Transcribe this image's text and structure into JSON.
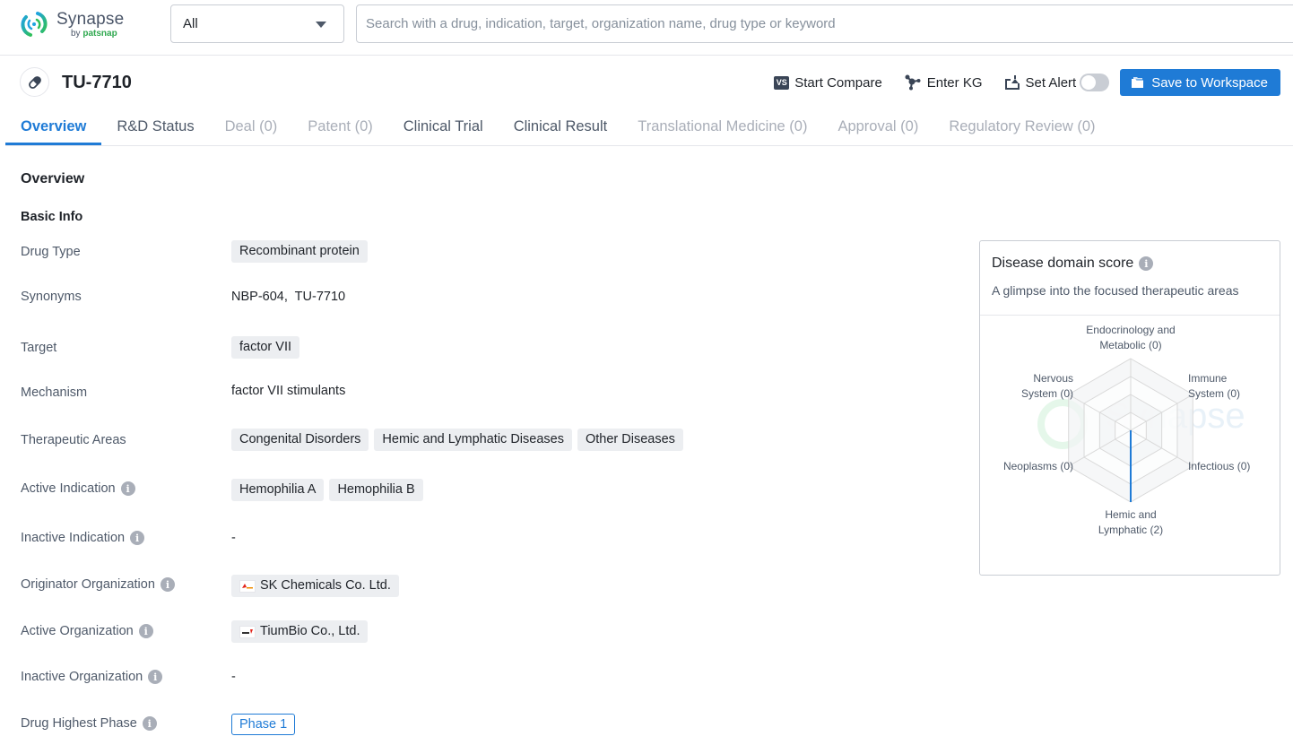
{
  "app": {
    "brand_name": "Synapse",
    "brand_sub_prefix": "by",
    "brand_sub_name": "patsnap"
  },
  "search": {
    "scope_value": "All",
    "placeholder": "Search with a drug, indication, target, organization name, drug type or keyword",
    "value": ""
  },
  "drug": {
    "name": "TU-7710",
    "icon": "pill-icon"
  },
  "actions": {
    "compare_badge": "VS",
    "compare_label": "Start Compare",
    "kg_label": "Enter KG",
    "alert_label": "Set Alert",
    "alert_on": false,
    "save_label": "Save to Workspace"
  },
  "tabs": [
    {
      "label": "Overview",
      "state": "active"
    },
    {
      "label": "R&D Status",
      "state": "enabled"
    },
    {
      "label": "Deal (0)",
      "state": "disabled"
    },
    {
      "label": "Patent (0)",
      "state": "disabled"
    },
    {
      "label": "Clinical Trial",
      "state": "enabled"
    },
    {
      "label": "Clinical Result",
      "state": "enabled"
    },
    {
      "label": "Translational Medicine (0)",
      "state": "disabled"
    },
    {
      "label": "Approval (0)",
      "state": "disabled"
    },
    {
      "label": "Regulatory Review (0)",
      "state": "disabled"
    }
  ],
  "overview": {
    "section_title": "Overview",
    "basic_info_title": "Basic Info",
    "fields": {
      "drug_type": {
        "label": "Drug Type",
        "tags": [
          "Recombinant protein"
        ]
      },
      "synonyms": {
        "label": "Synonyms",
        "text": "NBP-604,  TU-7710"
      },
      "target": {
        "label": "Target",
        "tags": [
          "factor VII"
        ]
      },
      "mechanism": {
        "label": "Mechanism",
        "text": "factor VII stimulants"
      },
      "therapeutic_areas": {
        "label": "Therapeutic Areas",
        "tags": [
          "Congenital Disorders",
          "Hemic and Lymphatic Diseases",
          "Other Diseases"
        ]
      },
      "active_indication": {
        "label": "Active Indication",
        "tags": [
          "Hemophilia A",
          "Hemophilia B"
        ]
      },
      "inactive_indication": {
        "label": "Inactive Indication",
        "text": "-"
      },
      "originator_org": {
        "label": "Originator Organization",
        "org": "SK Chemicals Co. Ltd."
      },
      "active_org": {
        "label": "Active Organization",
        "org": "TiumBio Co., Ltd."
      },
      "inactive_org": {
        "label": "Inactive Organization",
        "text": "-"
      },
      "highest_phase": {
        "label": "Drug Highest Phase",
        "phase": "Phase 1"
      }
    }
  },
  "disease_domain": {
    "title": "Disease domain score",
    "subtitle": "A glimpse into the focused therapeutic areas",
    "watermark": "Synapse by patsnap"
  },
  "chart_data": {
    "type": "radar",
    "title": "Disease domain score",
    "categories": [
      "Endocrinology and Metabolic",
      "Immune System",
      "Infectious",
      "Hemic and Lymphatic",
      "Neoplasms",
      "Nervous System"
    ],
    "labels": [
      [
        "Endocrinology and",
        "Metabolic (0)"
      ],
      [
        "Immune",
        "System (0)"
      ],
      [
        "Infectious (0)"
      ],
      [
        "Hemic and",
        "Lymphatic (2)"
      ],
      [
        "Neoplasms (0)"
      ],
      [
        "Nervous",
        "System (0)"
      ]
    ],
    "values": [
      0,
      0,
      0,
      2,
      0,
      0
    ],
    "max": 2,
    "rings": 4,
    "series_color": "#1f7bd6",
    "grid": true
  }
}
